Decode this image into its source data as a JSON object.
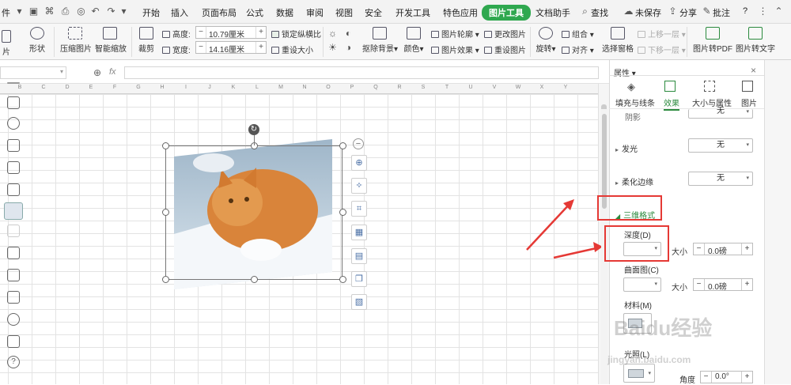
{
  "menubar": {
    "file_partial": "件",
    "items": [
      "开始",
      "插入",
      "页面布局",
      "公式",
      "数据",
      "审阅",
      "视图",
      "安全",
      "开发工具",
      "特色应用",
      "图片工具",
      "文档助手"
    ],
    "active_item": "图片工具",
    "search": "查找",
    "unsaved": "未保存",
    "share": "分享",
    "annotate": "批注",
    "help": "?"
  },
  "ribbon": {
    "left_partial": "片",
    "shape": "形状",
    "compress": "压缩图片",
    "smart_zoom": "智能缩放",
    "crop": "裁剪",
    "height_label": "高度:",
    "height_value": "10.79厘米",
    "width_label": "宽度:",
    "width_value": "14.16厘米",
    "lock_ratio": "锁定纵横比",
    "reset_size": "重设大小",
    "remove_bg": "抠除背景",
    "color": "颜色",
    "outline": "图片轮廓",
    "effects": "图片效果",
    "change_pic": "更改图片",
    "reset_pic": "重设图片",
    "rotate": "旋转",
    "group": "组合",
    "align": "对齐",
    "selection_pane": "选择窗格",
    "bring_forward": "上移一层",
    "send_backward": "下移一层",
    "to_pdf": "图片转PDF",
    "to_text": "图片转文字"
  },
  "formulabar": {
    "fx": "fx"
  },
  "columns": [
    "B",
    "C",
    "D",
    "E",
    "F",
    "G",
    "H",
    "I",
    "J",
    "K",
    "L",
    "M",
    "N",
    "O",
    "P",
    "Q",
    "R",
    "S",
    "T",
    "U",
    "V",
    "W",
    "X",
    "Y"
  ],
  "pane": {
    "title": "属性",
    "tabs": [
      "填充与线条",
      "效果",
      "大小与属性",
      "图片"
    ],
    "active_tab": "效果",
    "shadow_label": "阴影",
    "shadow_value": "无",
    "glow_label": "发光",
    "glow_value": "无",
    "soft_edge_label": "柔化边缘",
    "soft_edge_value": "无",
    "threed_label": "三维格式",
    "depth_label": "深度(D)",
    "size_label": "大小",
    "depth_size": "0.0磅",
    "contour_label": "曲面图(C)",
    "contour_size": "0.0磅",
    "material_label": "材料(M)",
    "lighting_label": "光照(L)",
    "angle_label": "角度",
    "angle_value": "0.0°"
  },
  "watermark": {
    "brand": "Baidu经验",
    "url": "jingyan.baidu.com"
  },
  "colors": {
    "accent_green": "#2fa84f",
    "highlight_red": "#e53935"
  }
}
